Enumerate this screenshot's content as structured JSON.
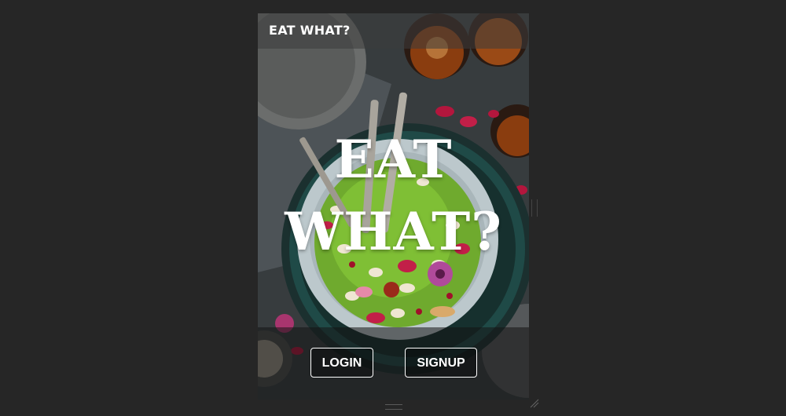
{
  "header": {
    "title": "EAT WHAT?"
  },
  "hero": {
    "line1": "EAT",
    "line2": "WHAT?"
  },
  "actions": {
    "login_label": "LOGIN",
    "signup_label": "SIGNUP"
  },
  "colors": {
    "page_background": "#262626",
    "text": "#ffffff",
    "plate": "#bcc8cc",
    "bowl_rim": "#1f4a47",
    "food_green": "#6faa2e",
    "petal_red": "#b3163d",
    "whisky": "#8a3d0f"
  }
}
